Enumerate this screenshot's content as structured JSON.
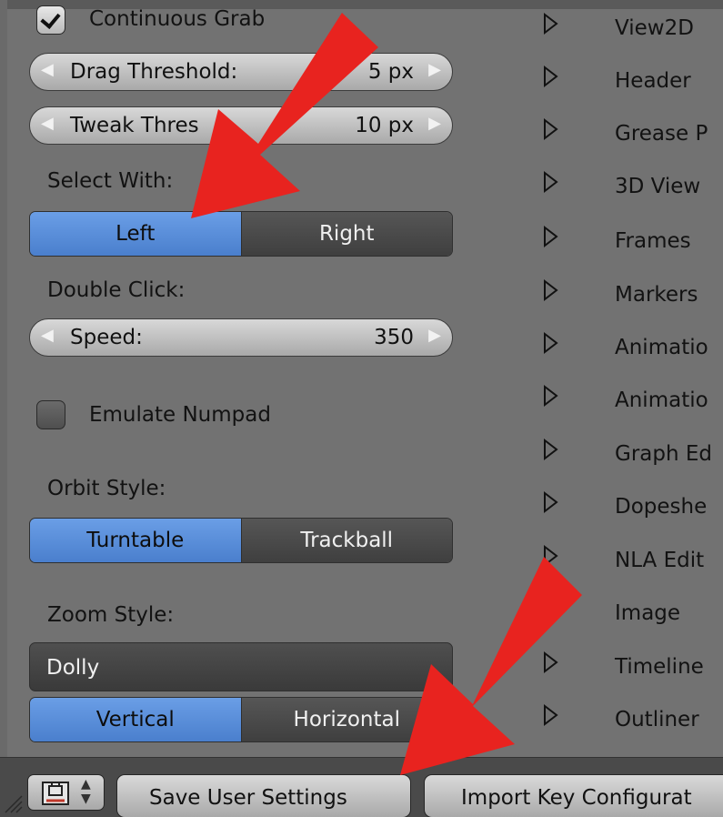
{
  "input": {
    "continuous_grab": {
      "label": "Continuous Grab",
      "checked": true
    },
    "drag_threshold": {
      "label": "Drag Threshold:",
      "value": "5 px"
    },
    "tweak_threshold": {
      "label": "Tweak Thres",
      "value": "10 px"
    },
    "select_with": {
      "label": "Select With:",
      "options": [
        "Left",
        "Right"
      ],
      "active": "Left"
    },
    "double_click": {
      "label": "Double Click:",
      "speed_label": "Speed:",
      "speed_value": "350"
    },
    "emulate_numpad": {
      "label": "Emulate Numpad",
      "checked": false
    },
    "orbit_style": {
      "label": "Orbit Style:",
      "options": [
        "Turntable",
        "Trackball"
      ],
      "active": "Turntable"
    },
    "zoom_style": {
      "label": "Zoom Style:",
      "value": "Dolly",
      "options": [
        "Vertical",
        "Horizontal"
      ],
      "active": "Vertical"
    }
  },
  "keymap_list": {
    "items": [
      "View2D",
      "Header",
      "Grease P",
      "3D View",
      "Frames",
      "Markers",
      "Animatio",
      "Animatio",
      "Graph Ed",
      "Dopeshe",
      "NLA Edit",
      "Image",
      "Timeline",
      "Outliner"
    ],
    "expand_icon": "triangle-right-icon"
  },
  "bottombar": {
    "save_button": "Save User Settings",
    "import_button": "Import Key Configurat",
    "editor_icon": "user-preferences-icon"
  },
  "colors": {
    "panel_bg": "#727272",
    "active_blue": "#5a8edb",
    "annotation_arrow": "#e8231f"
  }
}
